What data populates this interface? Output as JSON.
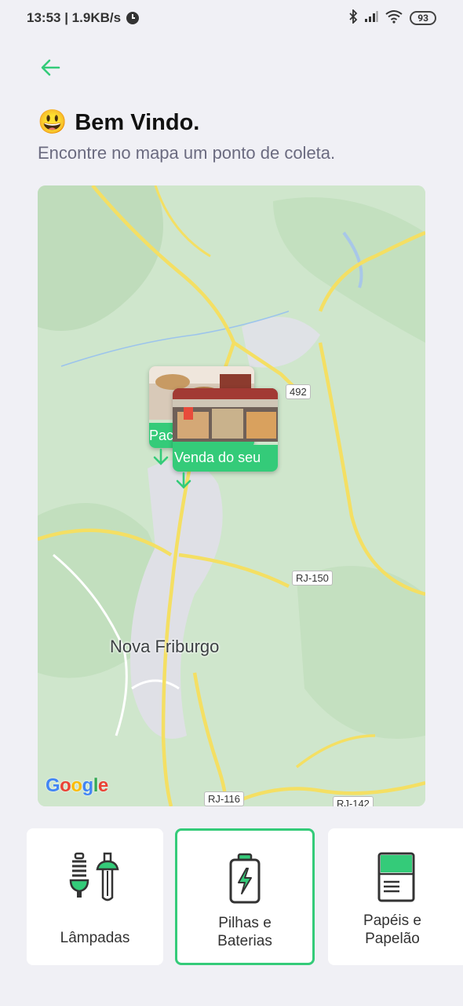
{
  "status_bar": {
    "time": "13:53 | 1.9KB/s",
    "battery": "93"
  },
  "header": {
    "back_icon": "arrow-left-icon",
    "emoji": "😃",
    "title": "Bem Vindo.",
    "subtitle": "Encontre no mapa um ponto de coleta."
  },
  "map": {
    "city": "Nova Friburgo",
    "roads": [
      "492",
      "RJ-150",
      "RJ-116",
      "RJ-142"
    ],
    "attribution": "Google",
    "markers": [
      {
        "label": "Pac"
      },
      {
        "label": "Venda do seu"
      }
    ]
  },
  "categories": [
    {
      "label": "Lâmpadas",
      "icon": "lightbulbs-icon",
      "selected": false
    },
    {
      "label": "Pilhas e Baterias",
      "icon": "battery-icon",
      "selected": true
    },
    {
      "label": "Papéis e Papelão",
      "icon": "paper-icon",
      "selected": false
    }
  ],
  "colors": {
    "accent": "#34cb79",
    "background": "#f0f0f5",
    "text_muted": "#6b6b80"
  }
}
